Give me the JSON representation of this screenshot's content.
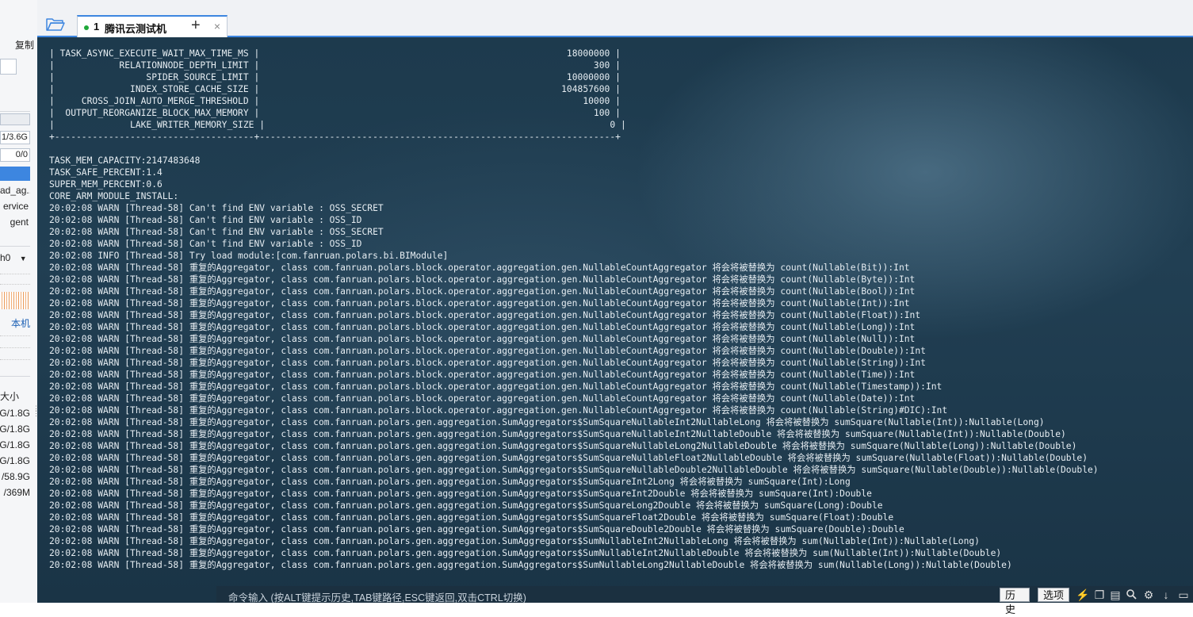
{
  "left_panel": {
    "copy_label": "复制",
    "mem_value": "1/3.6G",
    "swap_value": "0/0",
    "processes": [
      "",
      "ad_ag...",
      "ervice",
      "gent",
      ""
    ],
    "interface": "h0",
    "local_label": "本机",
    "size_header": "大小",
    "disk_usage": [
      "G/1.8G",
      "G/1.8G",
      "G/1.8G",
      "G/1.8G",
      "/58.9G",
      "/369M"
    ]
  },
  "tabs": [
    {
      "number": "1",
      "title": "腾讯云测试机",
      "status_color": "#1fa83a",
      "active": true
    }
  ],
  "icons": {
    "open_folder": "folder-icon",
    "new_tab": "plus-icon",
    "close_tab": "close-icon"
  },
  "terminal": {
    "background": "#1d3a4d",
    "text_color": "#e6edf2",
    "lines": [
      "| TASK_ASYNC_EXECUTE_WAIT_MAX_TIME_MS |                                                         18000000 |",
      "|            RELATIONNODE_DEPTH_LIMIT |                                                              300 |",
      "|                 SPIDER_SOURCE_LIMIT |                                                         10000000 |",
      "|              INDEX_STORE_CACHE_SIZE |                                                        104857600 |",
      "|     CROSS_JOIN_AUTO_MERGE_THRESHOLD |                                                            10000 |",
      "|  OUTPUT_REORGANIZE_BLOCK_MAX_MEMORY |                                                              100 |",
      "|              LAKE_WRITER_MEMORY_SIZE |                                                                0 |",
      "+-------------------------------------+------------------------------------------------------------------+",
      "",
      "TASK_MEM_CAPACITY:2147483648",
      "TASK_SAFE_PERCENT:1.4",
      "SUPER_MEM_PERCENT:0.6",
      "CORE_ARM_MODULE_INSTALL:",
      "20:02:08 WARN [Thread-58] Can't find ENV variable : OSS_SECRET",
      "20:02:08 WARN [Thread-58] Can't find ENV variable : OSS_ID",
      "20:02:08 WARN [Thread-58] Can't find ENV variable : OSS_SECRET",
      "20:02:08 WARN [Thread-58] Can't find ENV variable : OSS_ID",
      "20:02:08 INFO [Thread-58] Try load module:[com.fanruan.polars.bi.BIModule]",
      "20:02:08 WARN [Thread-58] 重复的Aggregator, class com.fanruan.polars.block.operator.aggregation.gen.NullableCountAggregator 将会将被替换为 count(Nullable(Bit)):Int",
      "20:02:08 WARN [Thread-58] 重复的Aggregator, class com.fanruan.polars.block.operator.aggregation.gen.NullableCountAggregator 将会将被替换为 count(Nullable(Byte)):Int",
      "20:02:08 WARN [Thread-58] 重复的Aggregator, class com.fanruan.polars.block.operator.aggregation.gen.NullableCountAggregator 将会将被替换为 count(Nullable(Bool)):Int",
      "20:02:08 WARN [Thread-58] 重复的Aggregator, class com.fanruan.polars.block.operator.aggregation.gen.NullableCountAggregator 将会将被替换为 count(Nullable(Int)):Int",
      "20:02:08 WARN [Thread-58] 重复的Aggregator, class com.fanruan.polars.block.operator.aggregation.gen.NullableCountAggregator 将会将被替换为 count(Nullable(Float)):Int",
      "20:02:08 WARN [Thread-58] 重复的Aggregator, class com.fanruan.polars.block.operator.aggregation.gen.NullableCountAggregator 将会将被替换为 count(Nullable(Long)):Int",
      "20:02:08 WARN [Thread-58] 重复的Aggregator, class com.fanruan.polars.block.operator.aggregation.gen.NullableCountAggregator 将会将被替换为 count(Nullable(Null)):Int",
      "20:02:08 WARN [Thread-58] 重复的Aggregator, class com.fanruan.polars.block.operator.aggregation.gen.NullableCountAggregator 将会将被替换为 count(Nullable(Double)):Int",
      "20:02:08 WARN [Thread-58] 重复的Aggregator, class com.fanruan.polars.block.operator.aggregation.gen.NullableCountAggregator 将会将被替换为 count(Nullable(String)):Int",
      "20:02:08 WARN [Thread-58] 重复的Aggregator, class com.fanruan.polars.block.operator.aggregation.gen.NullableCountAggregator 将会将被替换为 count(Nullable(Time)):Int",
      "20:02:08 WARN [Thread-58] 重复的Aggregator, class com.fanruan.polars.block.operator.aggregation.gen.NullableCountAggregator 将会将被替换为 count(Nullable(Timestamp)):Int",
      "20:02:08 WARN [Thread-58] 重复的Aggregator, class com.fanruan.polars.block.operator.aggregation.gen.NullableCountAggregator 将会将被替换为 count(Nullable(Date)):Int",
      "20:02:08 WARN [Thread-58] 重复的Aggregator, class com.fanruan.polars.block.operator.aggregation.gen.NullableCountAggregator 将会将被替换为 count(Nullable(String)#DIC):Int",
      "20:02:08 WARN [Thread-58] 重复的Aggregator, class com.fanruan.polars.gen.aggregation.SumAggregators$SumSquareNullableInt2NullableLong 将会将被替换为 sumSquare(Nullable(Int)):Nullable(Long)",
      "20:02:08 WARN [Thread-58] 重复的Aggregator, class com.fanruan.polars.gen.aggregation.SumAggregators$SumSquareNullableInt2NullableDouble 将会将被替换为 sumSquare(Nullable(Int)):Nullable(Double)",
      "20:02:08 WARN [Thread-58] 重复的Aggregator, class com.fanruan.polars.gen.aggregation.SumAggregators$SumSquareNullableLong2NullableDouble 将会将被替换为 sumSquare(Nullable(Long)):Nullable(Double)",
      "20:02:08 WARN [Thread-58] 重复的Aggregator, class com.fanruan.polars.gen.aggregation.SumAggregators$SumSquareNullableFloat2NullableDouble 将会将被替换为 sumSquare(Nullable(Float)):Nullable(Double)",
      "20:02:08 WARN [Thread-58] 重复的Aggregator, class com.fanruan.polars.gen.aggregation.SumAggregators$SumSquareNullableDouble2NullableDouble 将会将被替换为 sumSquare(Nullable(Double)):Nullable(Double)",
      "20:02:08 WARN [Thread-58] 重复的Aggregator, class com.fanruan.polars.gen.aggregation.SumAggregators$SumSquareInt2Long 将会将被替换为 sumSquare(Int):Long",
      "20:02:08 WARN [Thread-58] 重复的Aggregator, class com.fanruan.polars.gen.aggregation.SumAggregators$SumSquareInt2Double 将会将被替换为 sumSquare(Int):Double",
      "20:02:08 WARN [Thread-58] 重复的Aggregator, class com.fanruan.polars.gen.aggregation.SumAggregators$SumSquareLong2Double 将会将被替换为 sumSquare(Long):Double",
      "20:02:08 WARN [Thread-58] 重复的Aggregator, class com.fanruan.polars.gen.aggregation.SumAggregators$SumSquareFloat2Double 将会将被替换为 sumSquare(Float):Double",
      "20:02:08 WARN [Thread-58] 重复的Aggregator, class com.fanruan.polars.gen.aggregation.SumAggregators$SumSquareDouble2Double 将会将被替换为 sumSquare(Double):Double",
      "20:02:08 WARN [Thread-58] 重复的Aggregator, class com.fanruan.polars.gen.aggregation.SumAggregators$SumNullableInt2NullableLong 将会将被替换为 sum(Nullable(Int)):Nullable(Long)",
      "20:02:08 WARN [Thread-58] 重复的Aggregator, class com.fanruan.polars.gen.aggregation.SumAggregators$SumNullableInt2NullableDouble 将会将被替换为 sum(Nullable(Int)):Nullable(Double)",
      "20:02:08 WARN [Thread-58] 重复的Aggregator, class com.fanruan.polars.gen.aggregation.SumAggregators$SumNullableLong2NullableDouble 将会将被替换为 sum(Nullable(Long)):Nullable(Double)"
    ]
  },
  "command_bar": {
    "hint": "命令输入 (按ALT键提示历史,TAB键路径,ESC键返回,双击CTRL切换)",
    "history_label": "历史",
    "options_label": "选项",
    "tool_icons": [
      "lightning-icon",
      "copy-icon",
      "paste-icon",
      "search-icon",
      "gear-icon",
      "download-icon",
      "maximize-icon"
    ]
  }
}
